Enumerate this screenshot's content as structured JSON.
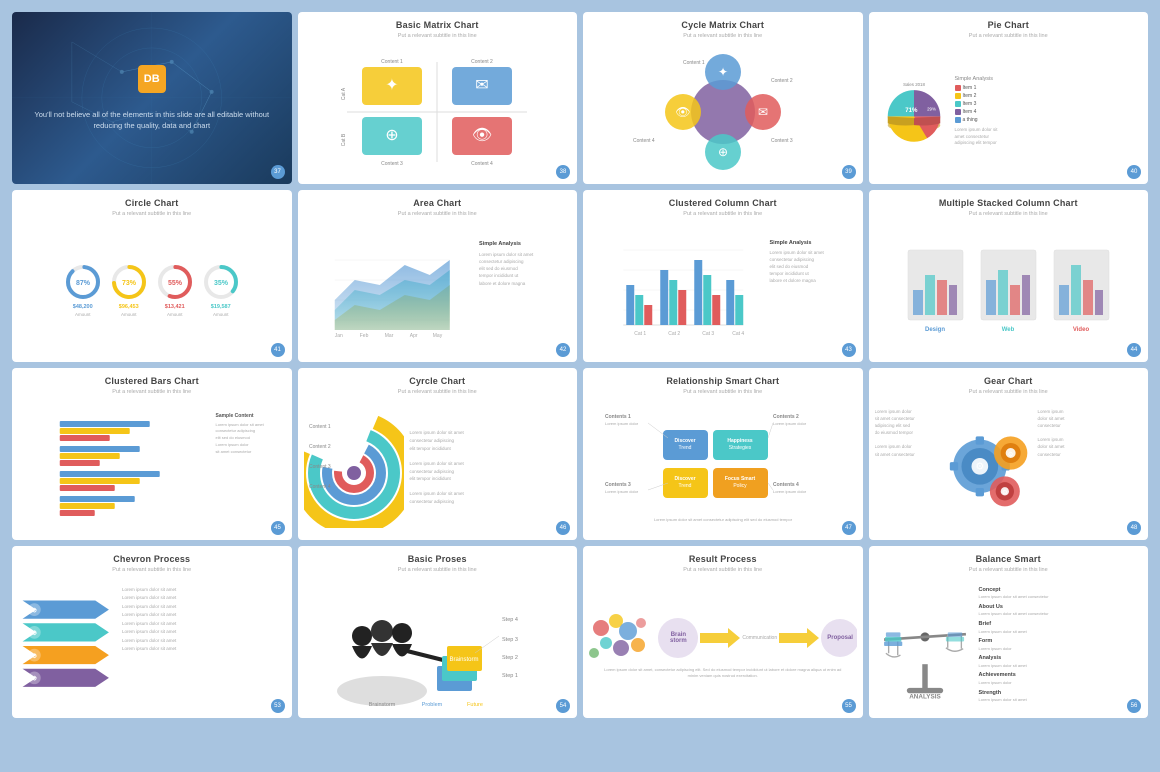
{
  "grid": {
    "cards": [
      {
        "id": "intro",
        "type": "intro",
        "logo": "DB",
        "text": "You'll not believe all of the elements in this slide are all editable without reducing the quality, data and chart",
        "badge": "37"
      },
      {
        "id": "basic-matrix",
        "type": "chart",
        "title": "Basic Matrix Chart",
        "subtitle": "Put a relevant subtitle in this line",
        "badge": "38"
      },
      {
        "id": "cycle-matrix",
        "type": "chart",
        "title": "Cycle Matrix Chart",
        "subtitle": "Put a relevant subtitle in this line",
        "badge": "39"
      },
      {
        "id": "pie",
        "type": "pie",
        "title": "Pie Chart",
        "subtitle": "Put a relevant subtitle in this line",
        "badge": "40",
        "label": "Sales 2018",
        "analysis": "Simple Analysis",
        "legend": [
          {
            "color": "#e05c5c",
            "label": "Item 1"
          },
          {
            "color": "#f5c518",
            "label": "Item 2"
          },
          {
            "color": "#4bc8c8",
            "label": "Item 3"
          },
          {
            "color": "#5b9bd5",
            "label": "Item 4"
          },
          {
            "color": "#8060a0",
            "label": "a thing"
          }
        ]
      },
      {
        "id": "circle",
        "type": "circle",
        "title": "Circle Chart",
        "subtitle": "Put a relevant subtitle in this line",
        "badge": "41",
        "items": [
          {
            "pct": 87,
            "color": "#5b9bd5",
            "val": "$48,200",
            "lbl": "Amount"
          },
          {
            "pct": 73,
            "color": "#f5c518",
            "val": "$96,453",
            "lbl": "Amount"
          },
          {
            "pct": 55,
            "color": "#e05c5c",
            "val": "$13,421",
            "lbl": "Amount"
          },
          {
            "pct": 35,
            "color": "#4bc8c8",
            "val": "$19,587",
            "lbl": "Amount"
          }
        ]
      },
      {
        "id": "area",
        "type": "area",
        "title": "Area Chart",
        "subtitle": "Put a relevant subtitle in this line",
        "badge": "42",
        "analysis": "Simple Analysis",
        "text_lines": [
          "Lorem ipsum dolor sit amet consectetur",
          "adipiscing elit sed do eiusmod",
          "tempor incididunt ut labore et dolore"
        ]
      },
      {
        "id": "clustered-column",
        "type": "clustered-column",
        "title": "Clustered Column Chart",
        "subtitle": "Put a relevant subtitle in this line",
        "badge": "43",
        "analysis": "Simple Analysis"
      },
      {
        "id": "multiple-stacked",
        "type": "multiple-stacked",
        "title": "Multiple Stacked Column Chart",
        "subtitle": "Put a relevant subtitle in this line",
        "badge": "44",
        "groups": [
          "Design",
          "Web",
          "Video"
        ]
      },
      {
        "id": "clustered-bars",
        "type": "clustered-bars",
        "title": "Clustered Bars Chart",
        "subtitle": "Put a relevant subtitle in this line",
        "badge": "45"
      },
      {
        "id": "cyrcle",
        "type": "cyrcle",
        "title": "Cyrcle Chart",
        "subtitle": "Put a relevant subtitle in this line",
        "badge": "46"
      },
      {
        "id": "relationship",
        "type": "relationship",
        "title": "Relationship Smart Chart",
        "subtitle": "Put a relevant subtitle in this line",
        "badge": "47",
        "nodes": [
          {
            "label": "Contents 1",
            "sublabel": "Lorem ipsum"
          },
          {
            "label": "Contents 2",
            "sublabel": "Lorem ipsum"
          },
          {
            "label": "Contents 3",
            "sublabel": "Lorem ipsum"
          },
          {
            "label": "Contents 4",
            "sublabel": "Lorem ipsum"
          }
        ],
        "center_nodes": [
          {
            "label": "Discover Trend",
            "color": "#5b9bd5"
          },
          {
            "label": "Happiness Strategies",
            "color": "#4bc8c8"
          },
          {
            "label": "Discover Trend",
            "color": "#f5c518"
          },
          {
            "label": "Focus Smart Policy",
            "color": "#f5c518"
          }
        ]
      },
      {
        "id": "gear",
        "type": "gear",
        "title": "Gear Chart",
        "subtitle": "Put a relevant subtitle in this line",
        "badge": "48"
      },
      {
        "id": "chevron",
        "type": "chevron",
        "title": "Chevron Process",
        "subtitle": "Put a relevant subtitle in this line",
        "badge": "53"
      },
      {
        "id": "basic-proses",
        "type": "basic-proses",
        "title": "Basic Proses",
        "subtitle": "Put a relevant subtitle in this line",
        "badge": "54",
        "steps": [
          "Step 4",
          "Step 3",
          "Step 2",
          "Step 1"
        ],
        "labels": [
          "Brainstorm",
          "Problem",
          "Future"
        ]
      },
      {
        "id": "result-process",
        "type": "result-process",
        "title": "Result Process",
        "subtitle": "Put a relevant subtitle in this line",
        "badge": "55",
        "nodes": [
          "Brainstorm",
          "Communication",
          "Proposal"
        ]
      },
      {
        "id": "balance",
        "type": "balance",
        "title": "Balance Smart",
        "subtitle": "Put a relevant subtitle in this line",
        "badge": "56",
        "analysis": "ANALYSIS",
        "sections": [
          "Concept",
          "About Us",
          "Brief",
          "Form",
          "Analysis",
          "Achievements",
          "Strength"
        ]
      }
    ]
  }
}
